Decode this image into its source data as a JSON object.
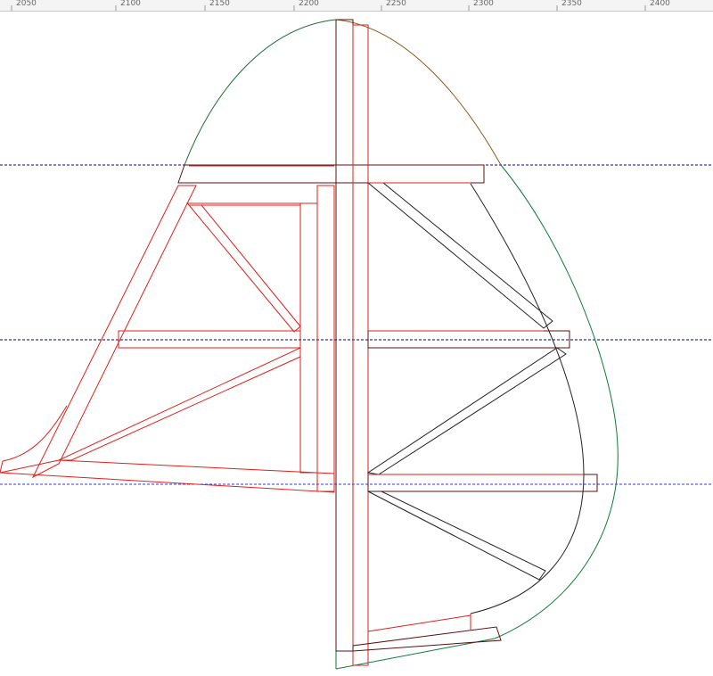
{
  "ruler": {
    "labels": [
      "2050",
      "2100",
      "2150",
      "2200",
      "2250",
      "2300",
      "2350",
      "2400"
    ]
  },
  "guides": {
    "upper_color": "#0000aa",
    "middle_color": "#000066",
    "lower_color": "#3333ff"
  },
  "colors": {
    "red_outline": "#e0201c",
    "black_outline": "#222222",
    "dark_outline": "#5a1010",
    "green_outline": "#0d7a3a",
    "tip_green": "#1e6b3a",
    "tip_brown": "#8a5a20"
  }
}
